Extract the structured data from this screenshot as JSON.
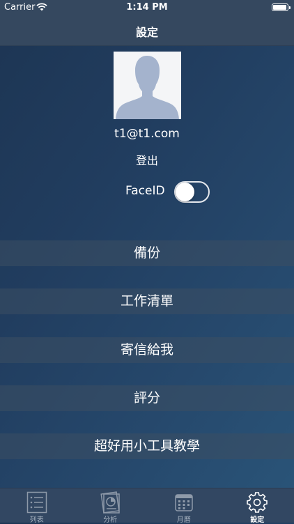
{
  "status_bar": {
    "carrier": "Carrier",
    "time": "1:14 PM"
  },
  "nav": {
    "title": "設定"
  },
  "profile": {
    "email": "t1@t1.com",
    "logout_label": "登出",
    "faceid_label": "FaceID",
    "faceid_enabled": false
  },
  "menu": {
    "items": [
      {
        "label": "備份"
      },
      {
        "label": "工作清單"
      },
      {
        "label": "寄信給我"
      },
      {
        "label": "評分"
      },
      {
        "label": "超好用小工具教學"
      }
    ]
  },
  "tabs": [
    {
      "label": "列表",
      "icon": "list-icon",
      "active": false
    },
    {
      "label": "分析",
      "icon": "chart-icon",
      "active": false
    },
    {
      "label": "月曆",
      "icon": "calendar-icon",
      "active": false
    },
    {
      "label": "設定",
      "icon": "gear-icon",
      "active": true
    }
  ],
  "colors": {
    "background_start": "#1d3553",
    "background_end": "#2a5579",
    "bar": "#35485f",
    "tab_bar": "#324762",
    "inactive_tab": "#a4b0be"
  }
}
